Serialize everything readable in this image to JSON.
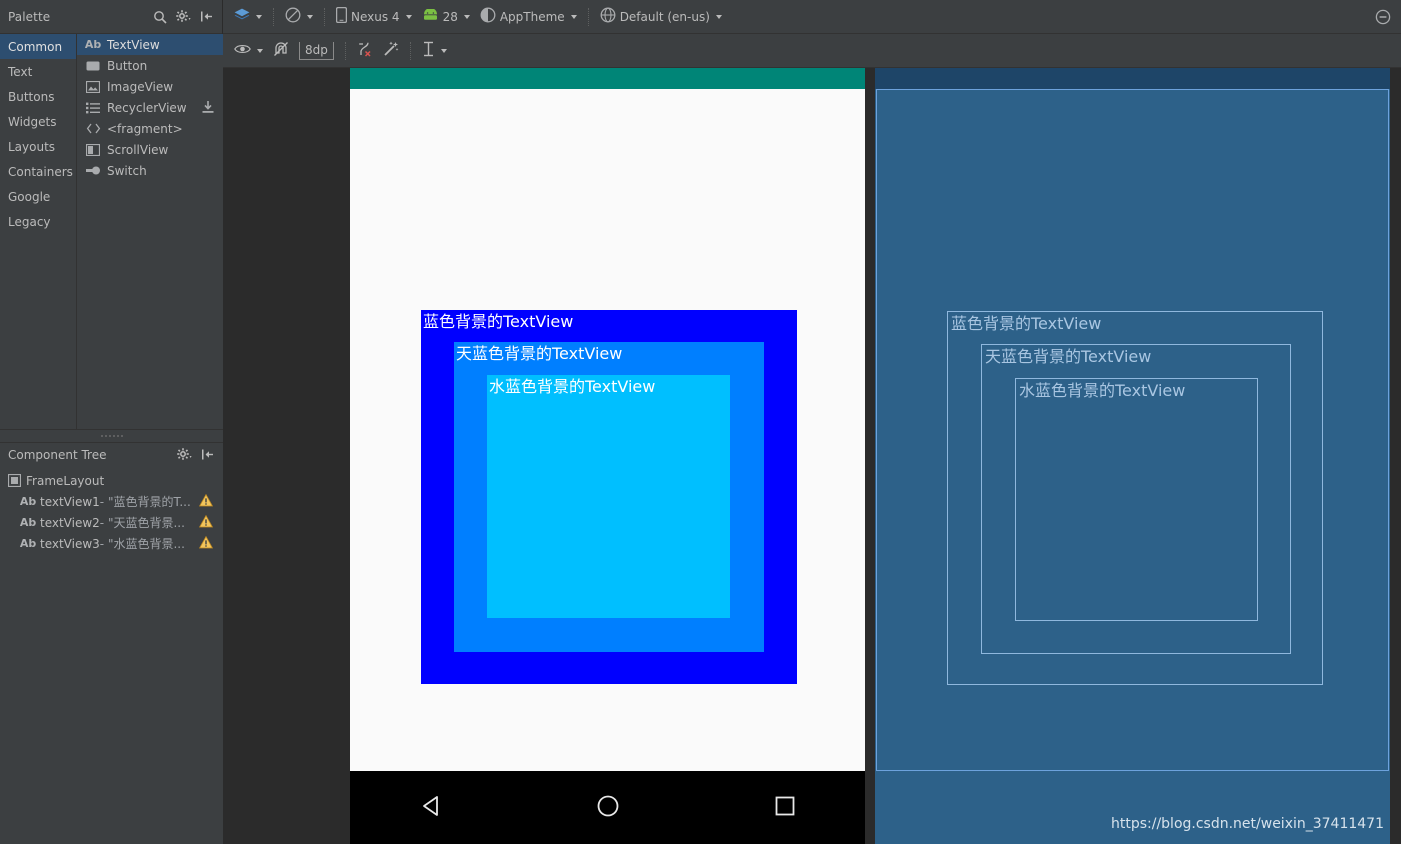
{
  "palette": {
    "title": "Palette",
    "header_icons": [
      {
        "name": "search-icon",
        "label": "Search"
      },
      {
        "name": "gear-icon",
        "label": "Settings"
      },
      {
        "name": "collapse-panel-icon",
        "label": "Hide"
      }
    ],
    "categories": [
      {
        "label": "Common",
        "selected": true
      },
      {
        "label": "Text",
        "selected": false
      },
      {
        "label": "Buttons",
        "selected": false
      },
      {
        "label": "Widgets",
        "selected": false
      },
      {
        "label": "Layouts",
        "selected": false
      },
      {
        "label": "Containers",
        "selected": false
      },
      {
        "label": "Google",
        "selected": false
      },
      {
        "label": "Legacy",
        "selected": false
      }
    ],
    "items": [
      {
        "label": "TextView",
        "icon": "textview-icon",
        "selected": true,
        "download": false
      },
      {
        "label": "Button",
        "icon": "button-icon",
        "selected": false,
        "download": false
      },
      {
        "label": "ImageView",
        "icon": "imageview-icon",
        "selected": false,
        "download": false
      },
      {
        "label": "RecyclerView",
        "icon": "recyclerview-icon",
        "selected": false,
        "download": true
      },
      {
        "label": "<fragment>",
        "icon": "fragment-icon",
        "selected": false,
        "download": false
      },
      {
        "label": "ScrollView",
        "icon": "scrollview-icon",
        "selected": false,
        "download": false
      },
      {
        "label": "Switch",
        "icon": "switch-icon",
        "selected": false,
        "download": false
      }
    ]
  },
  "component_tree": {
    "title": "Component Tree",
    "header_icons": [
      {
        "name": "gear-icon",
        "label": "Settings"
      },
      {
        "name": "collapse-panel-icon",
        "label": "Hide"
      }
    ],
    "nodes": [
      {
        "icon": "framelayout-icon",
        "name": "FrameLayout",
        "value": "",
        "level": 0,
        "warning": false
      },
      {
        "icon": "textview-icon",
        "name": "textView1",
        "value": "- \"蓝色背景的T...",
        "level": 1,
        "warning": true
      },
      {
        "icon": "textview-icon",
        "name": "textView2",
        "value": "- \"天蓝色背景...",
        "level": 1,
        "warning": true
      },
      {
        "icon": "textview-icon",
        "name": "textView3",
        "value": "- \"水蓝色背景...",
        "level": 1,
        "warning": true
      }
    ]
  },
  "toolbar_main": {
    "design_mode": {
      "label": "",
      "icon": "layers-icon"
    },
    "orientation": {
      "label": "",
      "icon": "orientation-icon"
    },
    "device": {
      "label": "Nexus 4",
      "icon": "phone-icon"
    },
    "api_level": {
      "label": "28",
      "icon": "android-icon"
    },
    "theme": {
      "label": "AppTheme",
      "icon": "theme-icon"
    },
    "locale": {
      "label": "Default (en-us)",
      "icon": "globe-icon"
    },
    "collapse": {
      "label": "",
      "icon": "minimize-circle-icon"
    }
  },
  "toolbar_design": {
    "visibility": {
      "label": "",
      "icon": "eye-icon"
    },
    "autoconnect": {
      "label": "",
      "icon": "magnet-off-icon"
    },
    "default_margin": {
      "label": "8dp",
      "icon": "margin-icon"
    },
    "clear_constraints": {
      "label": "",
      "icon": "clear-constraints-icon"
    },
    "infer_constraints": {
      "label": "",
      "icon": "magic-wand-icon"
    },
    "baseline_align": {
      "label": "",
      "icon": "baseline-icon"
    }
  },
  "preview": {
    "appbar_color": "#008577",
    "textviews": [
      {
        "label": "蓝色背景的TextView",
        "bg": "#0000FF",
        "name": "textview1"
      },
      {
        "label": "天蓝色背景的TextView",
        "bg": "#007FFF",
        "name": "textview2"
      },
      {
        "label": "水蓝色背景的TextView",
        "bg": "#00BFFF",
        "name": "textview3"
      }
    ],
    "navbar": {
      "back": "back-icon",
      "home": "home-icon",
      "recents": "recents-icon"
    }
  },
  "blueprint": {
    "bg_color": "#2D6189",
    "outline_color": "#8FB8DE",
    "textviews": [
      {
        "label": "蓝色背景的TextView",
        "name": "bp-textview1"
      },
      {
        "label": "天蓝色背景的TextView",
        "name": "bp-textview2"
      },
      {
        "label": "水蓝色背景的TextView",
        "name": "bp-textview3"
      }
    ]
  },
  "watermark": {
    "text": "https://blog.csdn.net/weixin_37411471"
  }
}
